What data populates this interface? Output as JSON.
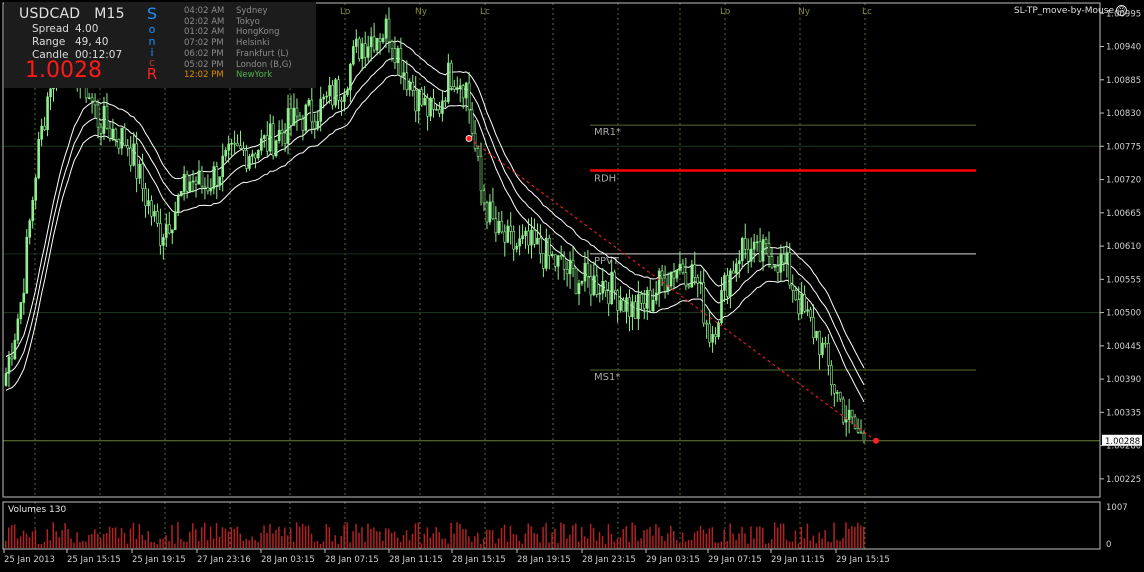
{
  "info_panel": {
    "symbol": "USDCAD",
    "timeframe": "M15",
    "spread_label": "Spread",
    "spread_value": "4.00",
    "range_label": "Range",
    "range_value": "49, 40",
    "candle_label": "Candle",
    "candle_value": "00:12:07",
    "price": "1.0028",
    "sonic_letters": [
      "S",
      "o",
      "n",
      "i",
      "c",
      "R"
    ],
    "sessions": [
      {
        "time": "04:02 AM",
        "name": "Sydney",
        "active": false
      },
      {
        "time": "02:02 AM",
        "name": "Tokyo",
        "active": false
      },
      {
        "time": "01:02 AM",
        "name": "HongKong",
        "active": false
      },
      {
        "time": "07:02 PM",
        "name": "Helsinki",
        "active": false
      },
      {
        "time": "06:02 PM",
        "name": "Frankfurt  (L)",
        "active": false
      },
      {
        "time": "05:02 PM",
        "name": "London  (B,G)",
        "active": false
      },
      {
        "time": "12:02 PM",
        "name": "NewYork",
        "active": true
      }
    ]
  },
  "ea_label": "SL-TP_move-by-Mouse",
  "colors": {
    "background": "#000000",
    "candle": "#90ee90",
    "band": "#ffffff",
    "rdh_line": "#ff0000",
    "pivot_line": "#556b2f",
    "price_line": "#6b7f3a",
    "session_vline": "#556b2f",
    "volume_bar": "#b22222",
    "info_panel_bg": "#1c1c1c",
    "price_text": "#ff1a1a",
    "sonic_blue": "#1e90ff",
    "sonic_red": "#ff2020"
  },
  "chart_data": {
    "type": "candlestick",
    "symbol": "USDCAD",
    "timeframe": "M15",
    "ylim": [
      1.00195,
      1.01012
    ],
    "y_ticks": [
      "1.00995",
      "1.00940",
      "1.00885",
      "1.00830",
      "1.00775",
      "1.00720",
      "1.00665",
      "1.00610",
      "1.00555",
      "1.00500",
      "1.00445",
      "1.00390",
      "1.00335",
      "1.00280",
      "1.00225"
    ],
    "current_price": "1.00288",
    "x_ticks": [
      "25 Jan 2013",
      "25 Jan 15:15",
      "25 Jan 19:15",
      "27 Jan 23:16",
      "28 Jan 03:15",
      "28 Jan 07:15",
      "28 Jan 11:15",
      "28 Jan 15:15",
      "28 Jan 19:15",
      "28 Jan 23:15",
      "29 Jan 03:15",
      "29 Jan 07:15",
      "29 Jan 11:15",
      "29 Jan 15:15"
    ],
    "session_markers": [
      "Lo",
      "Ny",
      "Lc",
      "Lo",
      "Ny",
      "Lc"
    ],
    "levels": [
      {
        "label": "MR1*",
        "value": 1.0081
      },
      {
        "label": "RDH",
        "value": 1.00735
      },
      {
        "label": "PPVT",
        "value": 1.00597
      },
      {
        "label": "MS1*",
        "value": 1.00405
      }
    ],
    "close_path": [
      1.004,
      1.0052,
      1.0075,
      1.009,
      1.0092,
      1.0089,
      1.0082,
      1.008,
      1.0078,
      1.007,
      1.0063,
      1.0067,
      1.0072,
      1.0071,
      1.0074,
      1.0076,
      1.0077,
      1.0078,
      1.008,
      1.0082,
      1.0083,
      1.0085,
      1.0088,
      1.0094,
      1.0096,
      1.0097,
      1.009,
      1.0085,
      1.0082,
      1.009,
      1.0088,
      1.007,
      1.0063,
      1.0061,
      1.0061,
      1.006,
      1.0058,
      1.0056,
      1.0055,
      1.0055,
      1.0053,
      1.005,
      1.0052,
      1.0056,
      1.0058,
      1.0056,
      1.0046,
      1.0055,
      1.0061,
      1.0059,
      1.006,
      1.0057,
      1.005,
      1.0046,
      1.0038,
      1.0032,
      1.00288
    ],
    "volumes": {
      "scale_max": 1007,
      "scale_min": 0
    },
    "volume_title": "Volumes 130"
  }
}
